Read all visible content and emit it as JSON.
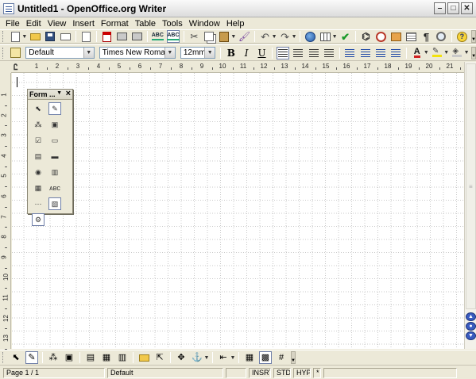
{
  "window": {
    "title": "Untitled1 - OpenOffice.org Writer"
  },
  "menu": [
    "File",
    "Edit",
    "View",
    "Insert",
    "Format",
    "Table",
    "Tools",
    "Window",
    "Help"
  ],
  "formatting": {
    "paragraph_style": "Default",
    "font_name": "Times New Roman",
    "font_size": "12mm",
    "bold_label": "B",
    "italic_label": "I",
    "underline_label": "U"
  },
  "ruler": {
    "horizontal_numbers": [
      "1",
      "2",
      "3",
      "4",
      "5",
      "6",
      "7",
      "8",
      "9",
      "10",
      "11",
      "12",
      "13",
      "14",
      "15",
      "16",
      "17",
      "18",
      "19",
      "20",
      "21"
    ],
    "vertical_numbers": [
      "1",
      "2",
      "3",
      "4",
      "5",
      "6",
      "7",
      "8",
      "9",
      "10",
      "11",
      "12",
      "13"
    ]
  },
  "form_toolbar": {
    "title": "Form ..."
  },
  "status": {
    "page": "Page 1 / 1",
    "style": "Default",
    "insert_mode": "INSRT",
    "selection_mode": "STD",
    "hyphenation": "HYP",
    "modified": "*"
  },
  "icons": {
    "title": "writer-app-icon",
    "help": "?"
  },
  "colors": {
    "font_color": "#d02020",
    "highlight_color": "#f3e20c",
    "background": "#ece9d8"
  }
}
